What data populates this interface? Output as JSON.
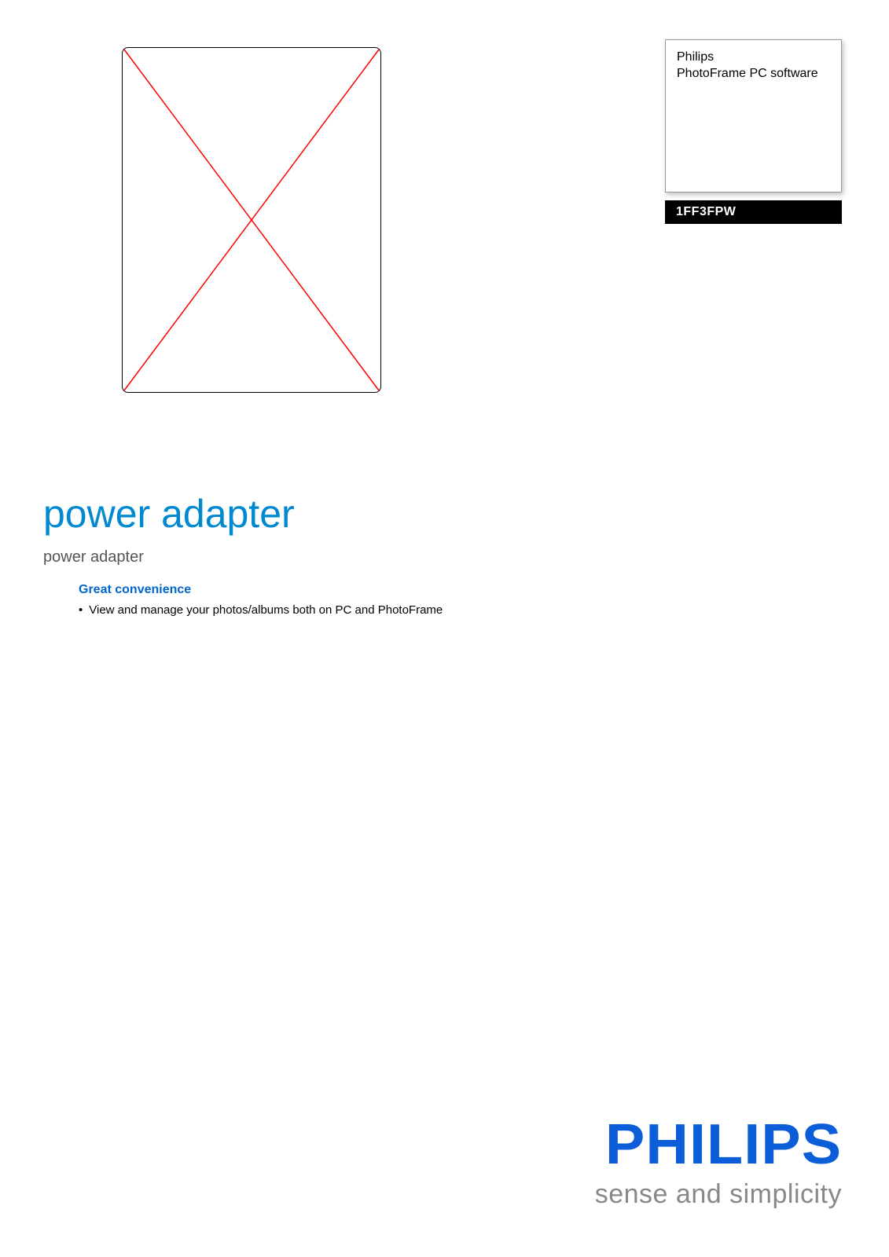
{
  "infoBox": {
    "brand": "Philips",
    "product": "PhotoFrame PC software"
  },
  "modelBar": "1FF3FPW",
  "title": "power adapter",
  "subtitle": "power adapter",
  "features": {
    "heading": "Great convenience",
    "items": [
      "View and manage your photos/albums both on PC and PhotoFrame"
    ]
  },
  "footer": {
    "logoText": "PHILIPS",
    "tagline_pre": "sense ",
    "tagline_and": "and",
    "tagline_post": " simplicity"
  }
}
